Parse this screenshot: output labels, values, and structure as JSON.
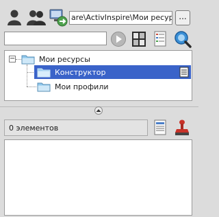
{
  "toolbar": {
    "path_value": "are\\ActivInspire\\Мои ресурсы",
    "browse_label": "..."
  },
  "search": {
    "value": ""
  },
  "tree": {
    "root": {
      "label": "Мои ресурсы",
      "expander": "−",
      "children": [
        {
          "label": "Конструктор",
          "selected": true
        },
        {
          "label": "Мои профили",
          "selected": false
        }
      ]
    }
  },
  "items": {
    "count_label": "0 элементов"
  },
  "colors": {
    "selection": "#3a63c9",
    "folder": "#8ec7ec"
  }
}
